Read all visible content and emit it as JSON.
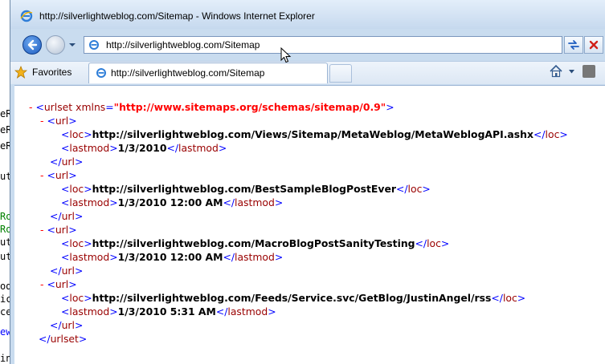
{
  "background_editor": {
    "lines": [
      {
        "text": "eR",
        "color": "#000000"
      },
      {
        "text": "eR",
        "color": "#000000"
      },
      {
        "text": "eR",
        "color": "#000000"
      },
      {
        "text": "ut",
        "color": "#000000"
      },
      {
        "text": "Ro",
        "color": "#008000"
      },
      {
        "text": "Ro",
        "color": "#008000"
      },
      {
        "text": "ut",
        "color": "#000000"
      },
      {
        "text": "ut",
        "color": "#000000"
      },
      {
        "text": "od",
        "color": "#000000"
      },
      {
        "text": "ic",
        "color": "#000000"
      },
      {
        "text": "ce",
        "color": "#000000"
      },
      {
        "text": "ew",
        "color": "#0000ff"
      },
      {
        "text": "in",
        "color": "#000000"
      }
    ]
  },
  "window": {
    "title": "http://silverlightweblog.com/Sitemap - Windows Internet Explorer"
  },
  "address_bar": {
    "value": "http://silverlightweblog.com/Sitemap"
  },
  "toolbar": {
    "favorites_label": "Favorites",
    "tab_label": "http://silverlightweblog.com/Sitemap"
  },
  "xml": {
    "root": {
      "minus": "-",
      "open_tag": "urlset",
      "attr_name": "xmlns",
      "attr_value": "\"http://www.sitemaps.org/schemas/sitemap/0.9\"",
      "close_tag": "urlset"
    },
    "urls": [
      {
        "loc": "http://silverlightweblog.com/Views/Sitemap/MetaWeblog/MetaWeblogAPI.ashx",
        "lastmod": "1/3/2010"
      },
      {
        "loc": "http://silverlightweblog.com/BestSampleBlogPostEver",
        "lastmod": "1/3/2010 12:00 AM"
      },
      {
        "loc": "http://silverlightweblog.com/MacroBlogPostSanityTesting",
        "lastmod": "1/3/2010 12:00 AM"
      },
      {
        "loc": "http://silverlightweblog.com/Feeds/Service.svc/GetBlog/JustinAngel/rss",
        "lastmod": "1/3/2010 5:31 AM"
      }
    ],
    "labels": {
      "url": "url",
      "loc": "loc",
      "lastmod": "lastmod",
      "minus": "-"
    }
  },
  "colors": {
    "xml_tag": "#990000",
    "xml_bracket": "#0000ff",
    "xml_minus": "#ff0000",
    "xml_attr_value": "#ff0000"
  }
}
